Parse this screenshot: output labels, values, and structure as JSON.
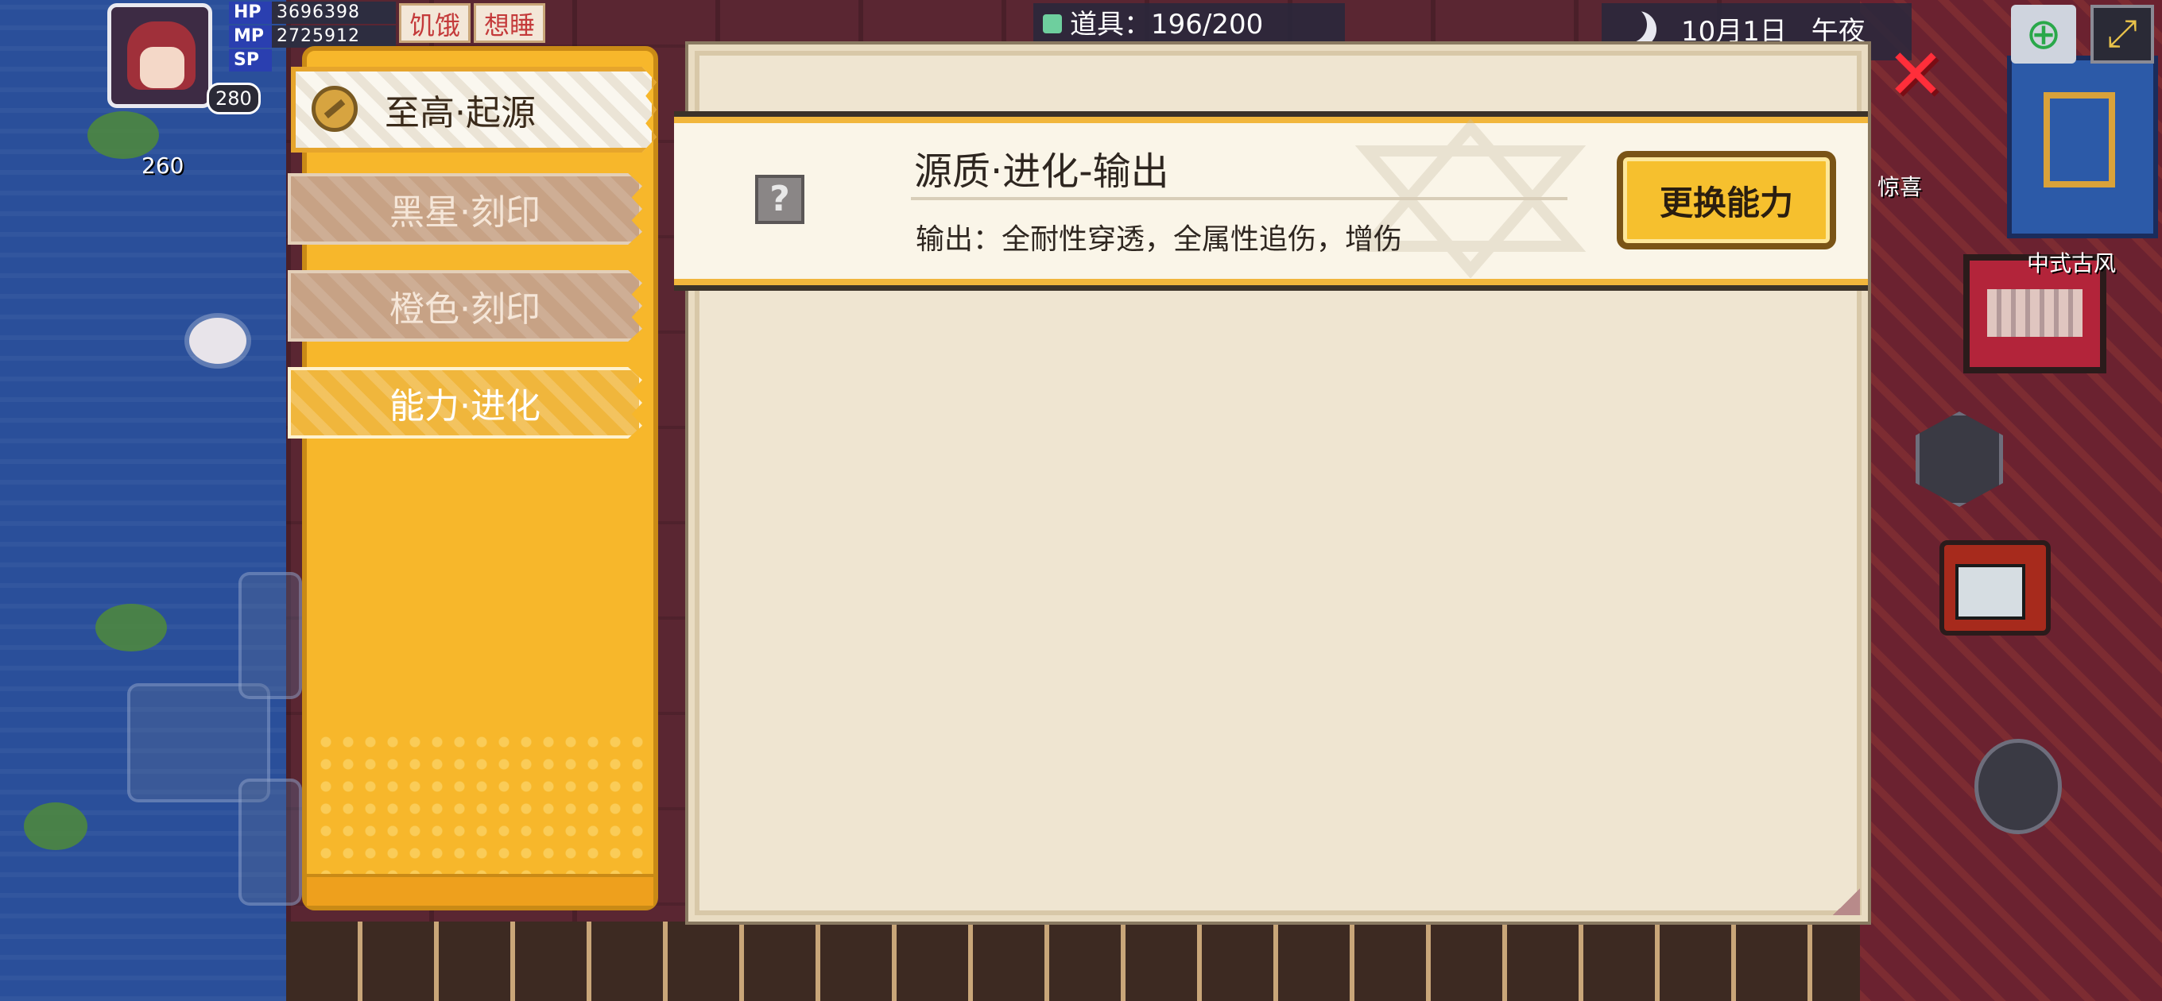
{
  "hud": {
    "hp_label": "HP",
    "hp_value": "3696398",
    "mp_label": "MP",
    "mp_value": "2725912",
    "sp_label": "SP",
    "level": "280",
    "status_hungry": "饥饿",
    "status_sleepy": "想睡",
    "items": "道具：196/200",
    "date": "10月1日",
    "time": "午夜",
    "currency_count": "260"
  },
  "scene": {
    "surprise_label": "惊喜",
    "decor_label": "中式古风"
  },
  "tabs": [
    {
      "label": "至高·起源",
      "state": "active"
    },
    {
      "label": "黑星·刻印",
      "state": "inactive"
    },
    {
      "label": "橙色·刻印",
      "state": "inactive"
    },
    {
      "label": "能力·进化",
      "state": "highlight"
    }
  ],
  "ability": {
    "name": "源质·进化-输出",
    "description": "输出：全耐性穿透，全属性追伤，增伤",
    "icon": "question-icon",
    "button_label": "更换能力"
  },
  "colors": {
    "accent_gold": "#f7b72b",
    "panel_bg": "#efe5d1",
    "close_red": "#ff2e3a"
  }
}
